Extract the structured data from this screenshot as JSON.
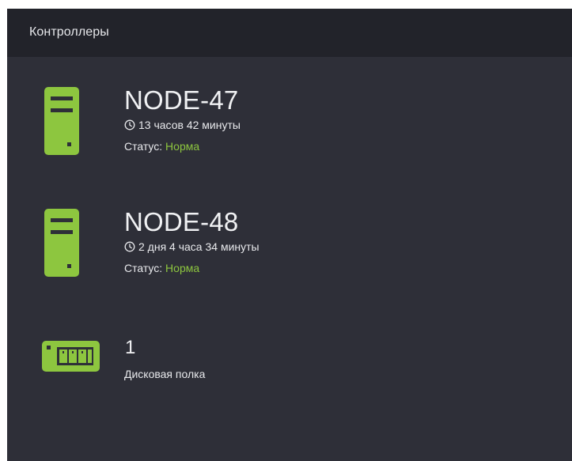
{
  "panel": {
    "title": "Контроллеры"
  },
  "colors": {
    "accent": "#8dc63f",
    "panel_bg": "#2e2f38",
    "header_bg": "#22232a",
    "text": "#e8e9ec"
  },
  "controllers": [
    {
      "name": "NODE-47",
      "icon": "server-tower-icon",
      "uptime_icon": "clock-icon",
      "uptime": "13 часов 42 минуты",
      "status_label": "Статус:",
      "status_value": "Норма"
    },
    {
      "name": "NODE-48",
      "icon": "server-tower-icon",
      "uptime_icon": "clock-icon",
      "uptime": "2 дня 4 часа 34 минуты",
      "status_label": "Статус:",
      "status_value": "Норма"
    }
  ],
  "disk_shelf": {
    "icon": "disk-shelf-icon",
    "count": "1",
    "label": "Дисковая полка"
  }
}
